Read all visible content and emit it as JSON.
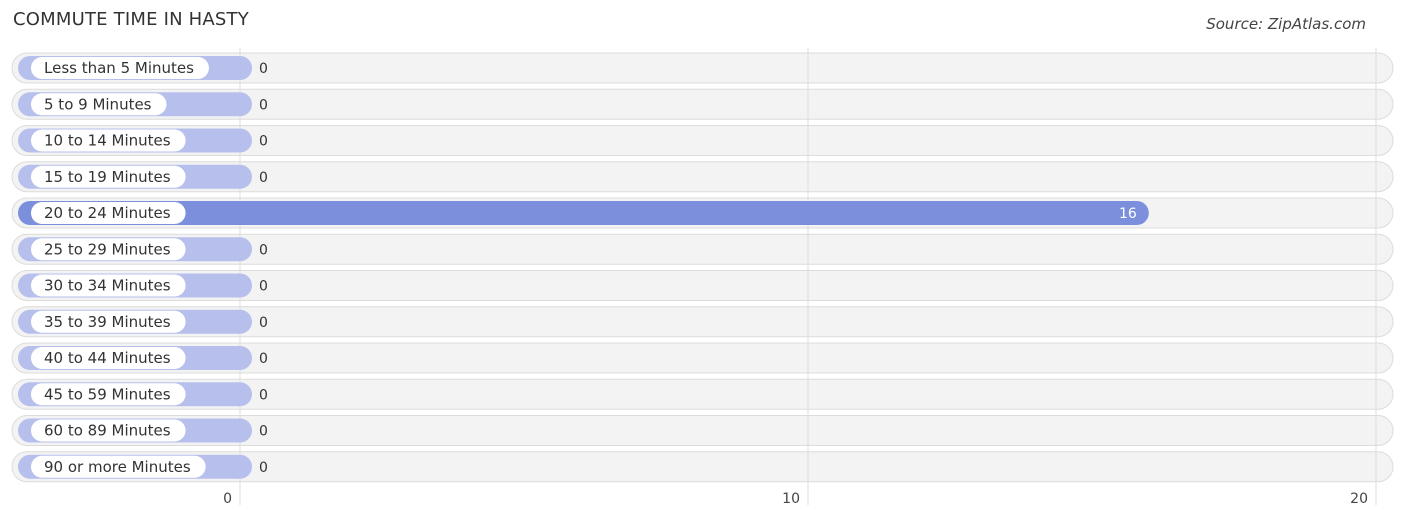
{
  "title": "COMMUTE TIME IN HASTY",
  "source": "Source: ZipAtlas.com",
  "colors": {
    "bar_zero": "#b7c0ec",
    "bar_highlight": "#7b8fdd",
    "row_bg": "#f3f3f3",
    "row_border": "#dcdcdc",
    "grid": "#dddddd"
  },
  "chart_data": {
    "type": "bar",
    "orientation": "horizontal",
    "title": "COMMUTE TIME IN HASTY",
    "xlabel": "",
    "ylabel": "",
    "categories": [
      "Less than 5 Minutes",
      "5 to 9 Minutes",
      "10 to 14 Minutes",
      "15 to 19 Minutes",
      "20 to 24 Minutes",
      "25 to 29 Minutes",
      "30 to 34 Minutes",
      "35 to 39 Minutes",
      "40 to 44 Minutes",
      "45 to 59 Minutes",
      "60 to 89 Minutes",
      "90 or more Minutes"
    ],
    "values": [
      0,
      0,
      0,
      0,
      16,
      0,
      0,
      0,
      0,
      0,
      0,
      0
    ],
    "xlim": [
      0,
      20
    ],
    "xticks": [
      0,
      10,
      20
    ],
    "grid": true,
    "legend": "none"
  }
}
